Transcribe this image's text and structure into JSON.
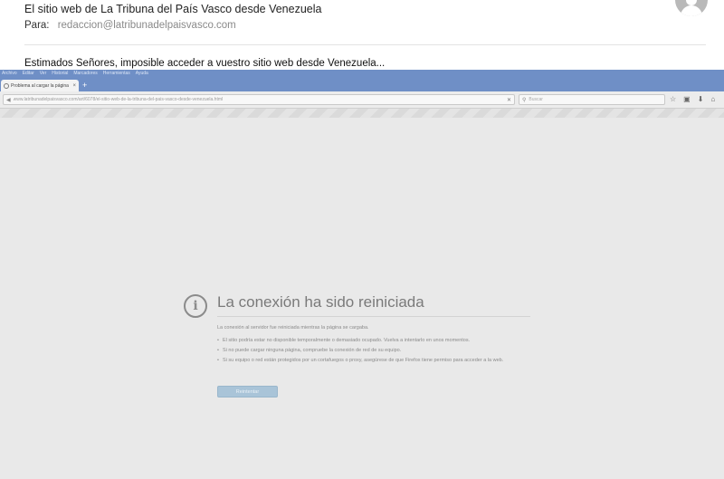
{
  "email": {
    "subject": "El sitio web de La Tribuna del País Vasco desde Venezuela",
    "to_label": "Para:",
    "to_address": "redaccion@latribunadelpaisvasco.com",
    "body": "Estimados Señores, imposible acceder a vuestro sitio web desde Venezuela..."
  },
  "browser": {
    "menu": [
      "Archivo",
      "Editar",
      "Ver",
      "Historial",
      "Marcadores",
      "Herramientas",
      "Ayuda"
    ],
    "tab_label": "Problema al cargar la página",
    "tab_close": "×",
    "new_tab": "+",
    "url": "www.latribunadelpaisvasco.com/art/6078/el-sitio-web-de-la-tribuna-del-pais-vasco-desde-venezuela.html",
    "search_placeholder": "Buscar",
    "error": {
      "title": "La conexión ha sido reiniciada",
      "description": "La conexión al servidor fue reiniciada mientras la página se cargaba.",
      "items": [
        "El sitio podría estar no disponible temporalmente o demasiado ocupado. Vuelva a intentarlo en unos momentos.",
        "Si no puede cargar ninguna página, compruebe la conexión de red de su equipo.",
        "Si su equipo o red están protegidos por un cortafuegos o proxy, asegúrese de que Firefox tiene permiso para acceder a la web."
      ],
      "retry_label": "Reintentar"
    }
  }
}
